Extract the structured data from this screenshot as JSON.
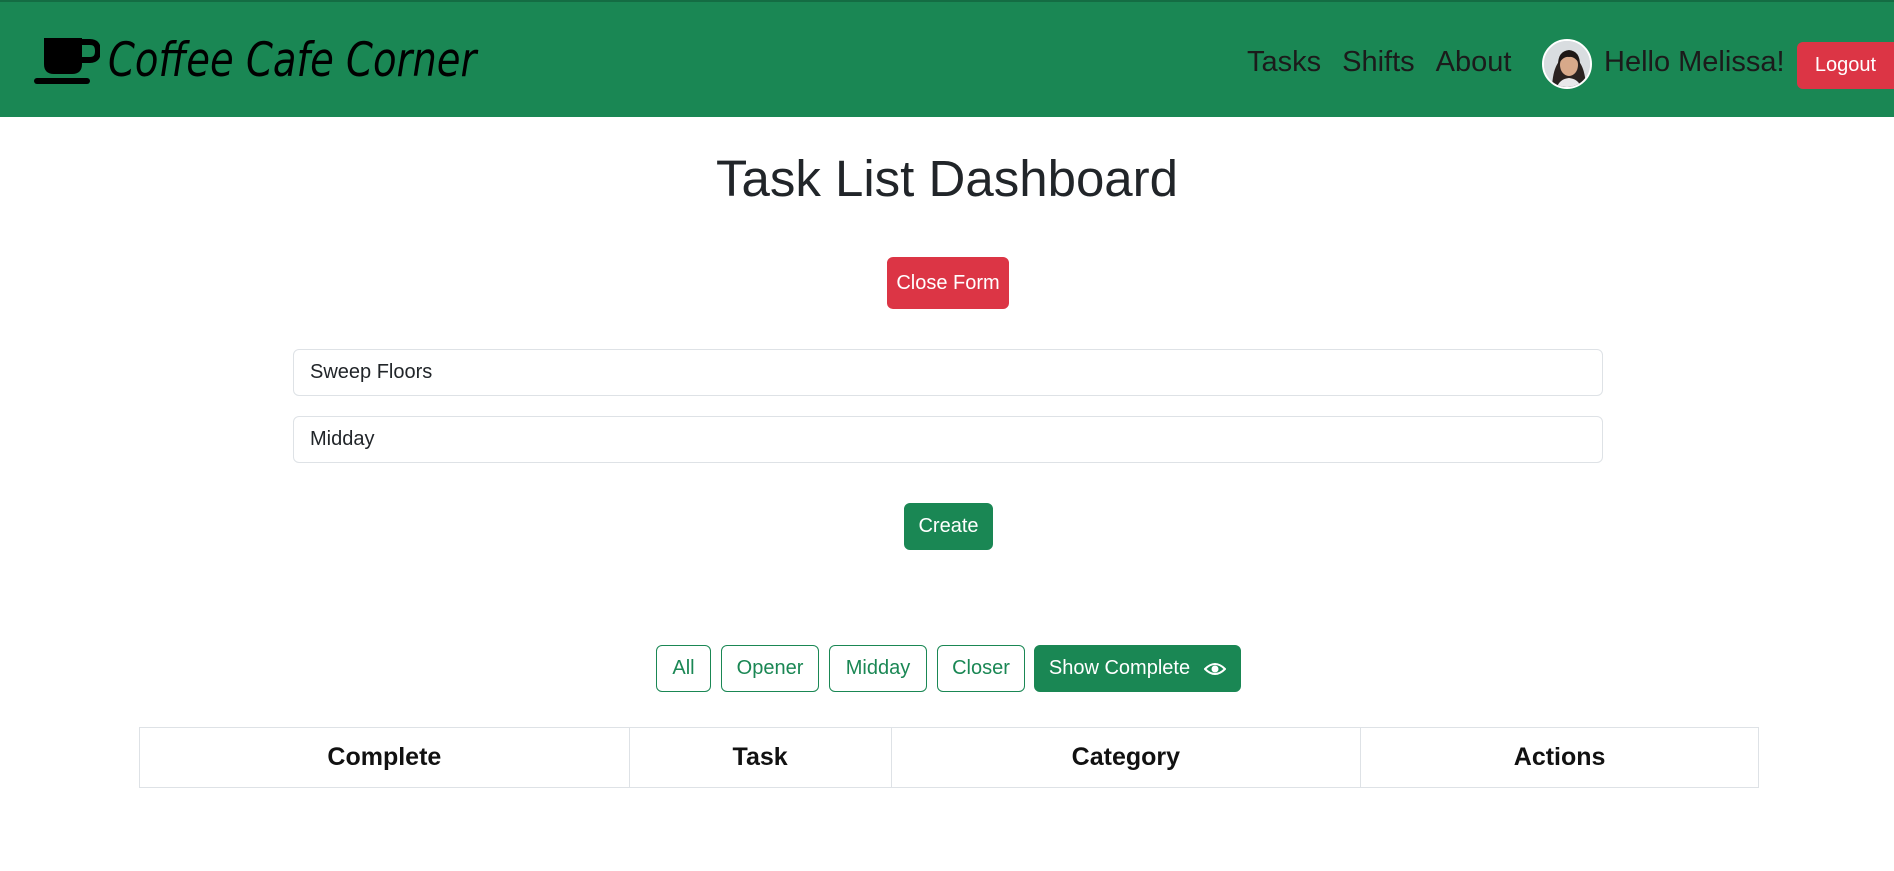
{
  "navbar": {
    "brand": "Coffee Cafe Corner",
    "brand_icon": "coffee-cup-icon",
    "links": [
      "Tasks",
      "Shifts",
      "About"
    ],
    "greeting": "Hello Melissa!",
    "logout_label": "Logout",
    "background_color": "#1a8754"
  },
  "main": {
    "title": "Task List Dashboard",
    "close_form_label": "Close Form",
    "task_input_value": "Sweep Floors",
    "category_input_value": "Midday",
    "create_label": "Create"
  },
  "filters": {
    "buttons": [
      "All",
      "Opener",
      "Midday",
      "Closer"
    ],
    "show_complete_label": "Show Complete",
    "show_complete_icon": "eye-icon"
  },
  "table": {
    "headers": [
      "Complete",
      "Task",
      "Category",
      "Actions"
    ]
  },
  "colors": {
    "primary": "#1a8754",
    "danger": "#dc3545"
  }
}
